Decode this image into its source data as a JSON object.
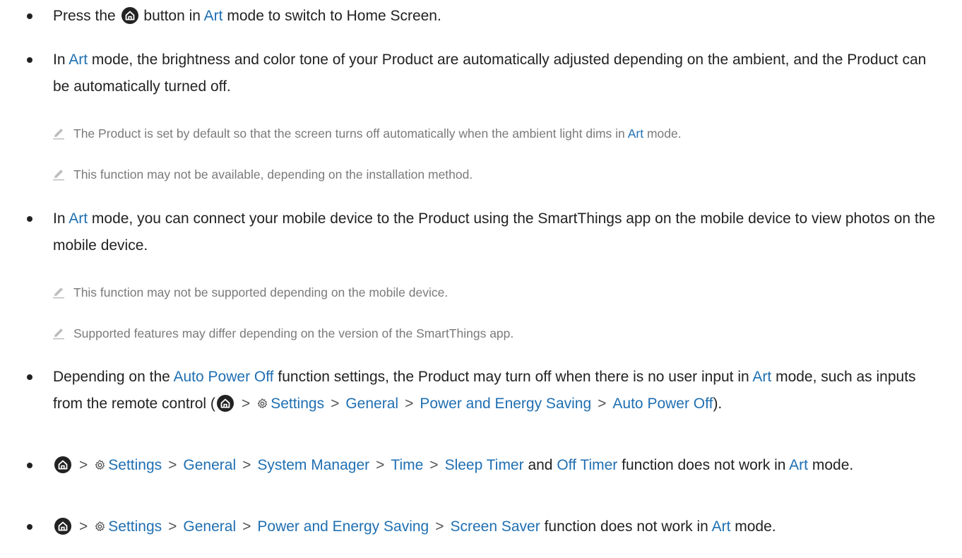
{
  "colors": {
    "link": "#1f6fb2",
    "text": "#222222",
    "note": "#7a7a7a"
  },
  "icons": {
    "home": "home-button-icon",
    "settings": "gear-icon",
    "note": "pencil-icon",
    "bullet": "bullet-dot"
  },
  "sep": ">",
  "items": {
    "b1": {
      "t1": "Press the",
      "t2": "button in",
      "art": "Art",
      "t3": "mode to switch to Home Screen."
    },
    "b2": {
      "t1": "In",
      "art": "Art",
      "t2": "mode, the brightness and color tone of your Product are automatically adjusted depending on the ambient, and the Product can be automatically turned off."
    },
    "n1": {
      "t1": "The Product is set by default so that the screen turns off automatically when the ambient light dims in",
      "art": "Art",
      "t2": "mode."
    },
    "n2": {
      "t1": "This function may not be available, depending on the installation method."
    },
    "b3": {
      "t1": "In",
      "art": "Art",
      "t2": "mode, you can connect your mobile device to the Product using the SmartThings app on the mobile device to view photos on the mobile device."
    },
    "n3": {
      "t1": "This function may not be supported depending on the mobile device."
    },
    "n4": {
      "t1": "Supported features may differ depending on the version of the SmartThings app."
    },
    "b4": {
      "t1": "Depending on the",
      "apo": "Auto Power Off",
      "t2": "function settings, the Product may turn off when there is no user input in",
      "art": "Art",
      "t3": "mode, such as inputs from the remote control (",
      "settings": "Settings",
      "general": "General",
      "pes": "Power and Energy Saving",
      "apo2": "Auto Power Off",
      "t4": ")."
    },
    "b5": {
      "settings": "Settings",
      "general": "General",
      "sysman": "System Manager",
      "time": "Time",
      "sleep": "Sleep Timer",
      "and": "and",
      "off": "Off Timer",
      "t1": "function does not work in",
      "art": "Art",
      "t2": "mode."
    },
    "b6": {
      "settings": "Settings",
      "general": "General",
      "pes": "Power and Energy Saving",
      "saver": "Screen Saver",
      "t1": "function does not work in",
      "art": "Art",
      "t2": "mode."
    }
  }
}
